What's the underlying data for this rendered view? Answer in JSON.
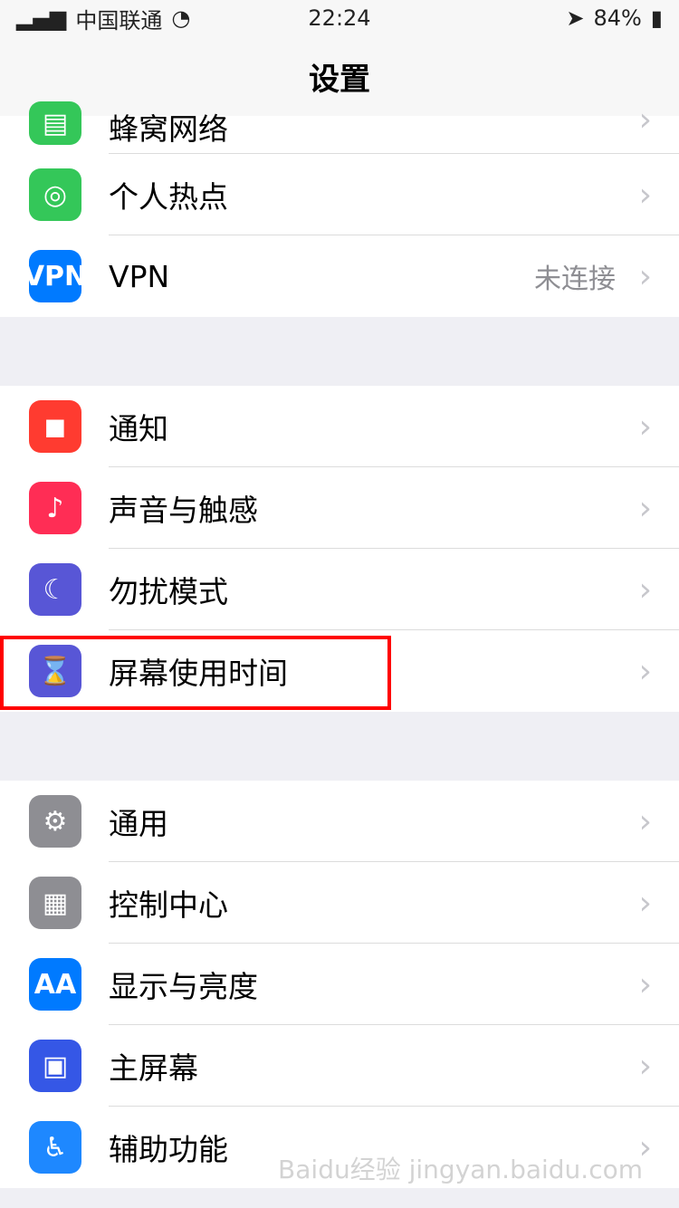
{
  "status": {
    "carrier": "中国联通",
    "time": "22:24",
    "battery": "84%"
  },
  "nav": {
    "title": "设置"
  },
  "rows_top": [
    {
      "label": "蜂窝网络",
      "icon": "cellular-icon",
      "color": "#34c759"
    },
    {
      "label": "个人热点",
      "icon": "hotspot-icon",
      "color": "#34c759"
    },
    {
      "label": "VPN",
      "icon": "vpn-icon",
      "color": "#007aff",
      "value": "未连接"
    }
  ],
  "rows_middle": [
    {
      "label": "通知",
      "icon": "notification-icon",
      "color": "#ff3b30"
    },
    {
      "label": "声音与触感",
      "icon": "sound-icon",
      "color": "#ff2d55"
    },
    {
      "label": "勿扰模式",
      "icon": "moon-icon",
      "color": "#5856d6"
    },
    {
      "label": "屏幕使用时间",
      "icon": "hourglass-icon",
      "color": "#5856d6"
    }
  ],
  "rows_bottom": [
    {
      "label": "通用",
      "icon": "gear-icon",
      "color": "#8e8e93"
    },
    {
      "label": "控制中心",
      "icon": "control-center-icon",
      "color": "#8e8e93"
    },
    {
      "label": "显示与亮度",
      "icon": "display-brightness-icon",
      "color": "#007aff"
    },
    {
      "label": "主屏幕",
      "icon": "home-screen-icon",
      "color": "#3557e6"
    },
    {
      "label": "辅助功能",
      "icon": "accessibility-icon",
      "color": "#1e88ff"
    }
  ],
  "watermark": "Baidu经验 jingyan.baidu.com"
}
